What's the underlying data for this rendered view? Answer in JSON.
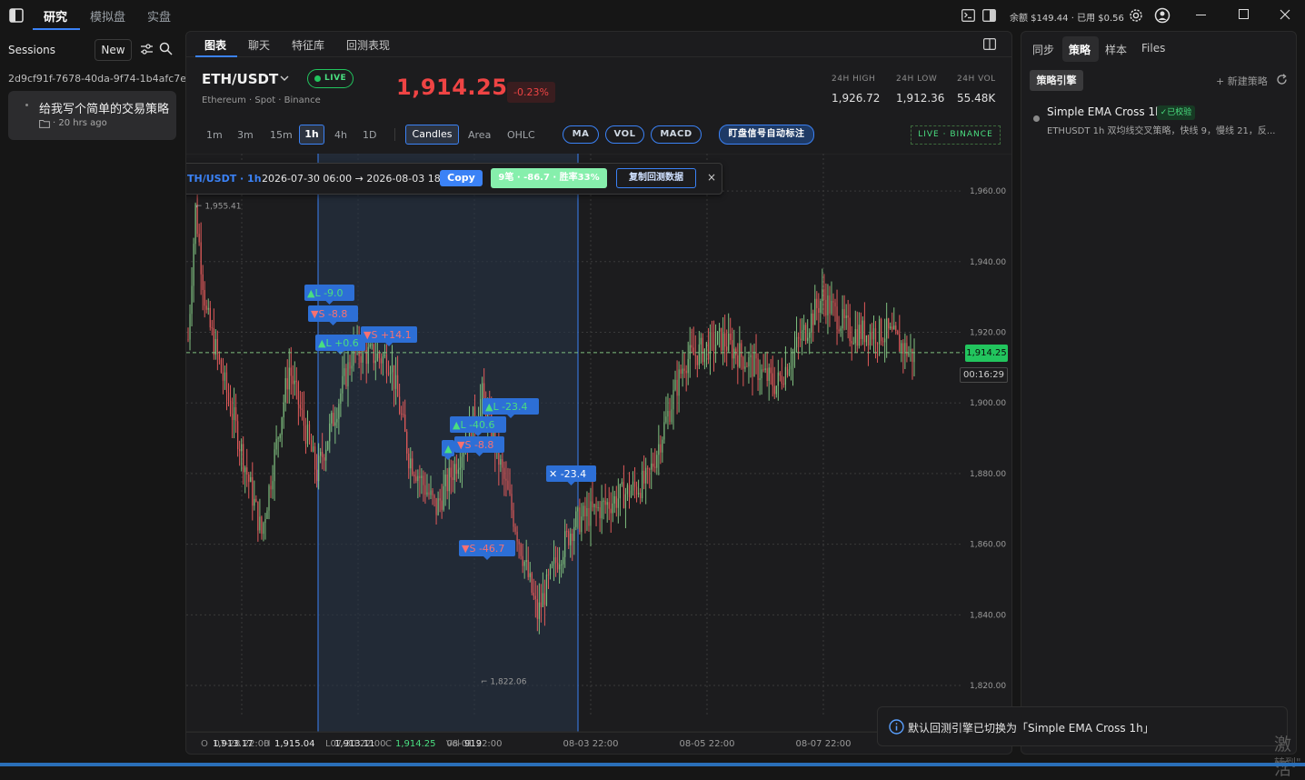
{
  "topbar": {
    "tabs": [
      "研究",
      "模拟盘",
      "实盘"
    ],
    "active_tab": 0,
    "balance": "余额 $149.44 · 已用 $0.56"
  },
  "sessions": {
    "title": "Sessions",
    "new_label": "New",
    "id": "2d9cf91f-7678-40da-9f74-1b4afc7e...",
    "item_title": "给我写个简单的交易策略",
    "item_time": "· 20 hrs ago"
  },
  "chart_tabs": [
    "图表",
    "聊天",
    "特征库",
    "回测表现"
  ],
  "ticker": {
    "symbol": "ETH/USDT",
    "live": "LIVE",
    "subtitle": "Ethereum · Spot · Binance",
    "price": "1,914.25",
    "change": "-0.23%",
    "high_label": "24H HIGH",
    "high": "1,926.72",
    "low_label": "24H LOW",
    "low": "1,912.36",
    "vol_label": "24H VOL",
    "vol": "55.48K"
  },
  "toolbar": {
    "timeframes": [
      "1m",
      "3m",
      "15m",
      "1h",
      "4h",
      "1D"
    ],
    "active_tf": "1h",
    "styles": [
      "Candles",
      "Area",
      "OHLC"
    ],
    "indicators": [
      "MA",
      "VOL",
      "MACD"
    ],
    "auto_label": "盯盘信号自动标注",
    "live_source": "LIVE · BINANCE"
  },
  "backtest_bar": {
    "range": "TH/USDT · 1h",
    "dates": "2026-07-30 06:00 → 2026-08-03 18:00",
    "copy": "Copy",
    "summary": "9笔 · -86.7 · 胜率33%",
    "copy_data": "复制回测数据",
    "close": "×"
  },
  "price_tag": "1,914.25",
  "countdown": "00:16:29",
  "ohlc": {
    "o_label": "O",
    "o": "1,913.17",
    "h_label": "H",
    "h": "1,915.04",
    "l_label": "L",
    "l": "1,913.11",
    "c_label": "C",
    "c": "1,914.25",
    "v_label": "Vol",
    "v": "919"
  },
  "right_panel": {
    "tabs": [
      "同步",
      "策略",
      "样本",
      "Files"
    ],
    "active_tab": 1,
    "engine_label": "策略引擎",
    "new_strategy": "+ 新建策略",
    "strategy_name": "Simple EMA Cross 1h",
    "verified": "✓已校验",
    "strategy_desc": "ETHUSDT 1h 双均线交叉策略，快线 9，慢线 21，反..."
  },
  "toast": "默认回测引擎已切换为「Simple EMA Cross 1h」",
  "watermark": "激活",
  "watermark2": "转到\"",
  "chart_data": {
    "type": "candlestick",
    "symbol": "ETH/USDT",
    "interval": "1h",
    "x_tick_labels": [
      "07-28 22:00",
      "07-30 22:00",
      "08-01 22:00",
      "08-03 22:00",
      "08-05 22:00",
      "08-07 22:00"
    ],
    "y_tick_values": [
      1960,
      1940,
      1920,
      1900,
      1880,
      1860,
      1840,
      1820
    ],
    "y_tick_labels": [
      "1,960.00",
      "1,940.00",
      "1,920.00",
      "1,900.00",
      "1,880.00",
      "1,860.00",
      "1,840.00",
      "1,820.00"
    ],
    "ylim": [
      1811,
      1968
    ],
    "price_anchors": [
      [
        0,
        1918
      ],
      [
        4,
        1955
      ],
      [
        10,
        1925
      ],
      [
        25,
        1895
      ],
      [
        40,
        1863
      ],
      [
        55,
        1910
      ],
      [
        70,
        1880
      ],
      [
        90,
        1915
      ],
      [
        110,
        1912
      ],
      [
        120,
        1885
      ],
      [
        135,
        1870
      ],
      [
        150,
        1888
      ],
      [
        160,
        1902
      ],
      [
        175,
        1872
      ],
      [
        190,
        1840
      ],
      [
        200,
        1855
      ],
      [
        210,
        1866
      ],
      [
        230,
        1872
      ],
      [
        250,
        1878
      ],
      [
        270,
        1912
      ],
      [
        290,
        1918
      ],
      [
        320,
        1905
      ],
      [
        345,
        1930
      ],
      [
        360,
        1920
      ],
      [
        380,
        1920
      ],
      [
        395,
        1913
      ]
    ],
    "high_marker": "1,955.41",
    "low_marker": "1,822.06",
    "current_price": 1914.25,
    "trade_markers": [
      {
        "label": "▲L -9.0",
        "color": "#4ade80"
      },
      {
        "label": "▼S -8.8",
        "color": "#f87171"
      },
      {
        "label": "▲L +0.6",
        "color": "#4ade80"
      },
      {
        "label": "▼S +14.1",
        "color": "#f87171"
      },
      {
        "label": "▲L -23.4",
        "color": "#4ade80"
      },
      {
        "label": "▲L -40.6",
        "color": "#4ade80"
      },
      {
        "label": "▼S -8.8",
        "color": "#f87171"
      },
      {
        "label": "▲",
        "color": "#4ade80"
      },
      {
        "label": "✕ -23.4",
        "color": "#ffffff"
      },
      {
        "label": "▼S -46.7",
        "color": "#f87171"
      }
    ],
    "up_color": "#7fbf7f",
    "down_color": "#e05a5a"
  },
  "colors": {
    "accent": "#3b82f6",
    "green": "#4ade80",
    "red": "#ef4444",
    "bg": "#161616",
    "panel": "#1c1c1e"
  }
}
